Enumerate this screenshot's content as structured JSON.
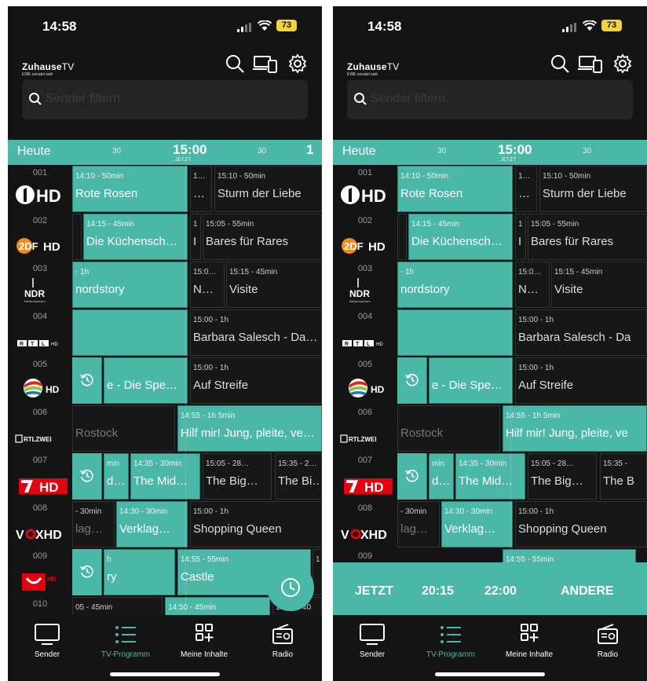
{
  "status": {
    "time": "14:58",
    "battery": "73"
  },
  "app": {
    "brand": "Zuhause",
    "brand_suffix": "TV",
    "tagline": "EWE osnatel swb"
  },
  "search": {
    "placeholder": "Sender filtern"
  },
  "timeline": {
    "day": "Heute",
    "half_left": "30",
    "current": "15:00",
    "now_label": "JETZT",
    "half_right": "30",
    "next_partial": "1"
  },
  "channels": [
    {
      "num": "001",
      "logo": "ARD HD",
      "logo_icon": "das-erste-hd-logo"
    },
    {
      "num": "002",
      "logo": "ZDF HD",
      "logo_icon": "zdf-hd-logo"
    },
    {
      "num": "003",
      "logo": "NDR",
      "logo_icon": "ndr-logo"
    },
    {
      "num": "004",
      "logo": "RTL HD",
      "logo_icon": "rtl-hd-logo"
    },
    {
      "num": "005",
      "logo": "SAT.1 HD",
      "logo_icon": "sat1-hd-logo"
    },
    {
      "num": "006",
      "logo": "RTLZWEI",
      "logo_icon": "rtlzwei-logo"
    },
    {
      "num": "007",
      "logo": "7 HD",
      "logo_icon": "pro7-hd-logo"
    },
    {
      "num": "008",
      "logo": "VOX HD",
      "logo_icon": "vox-hd-logo"
    },
    {
      "num": "009",
      "logo": "kabel eins HD",
      "logo_icon": "kabel-eins-hd-logo"
    },
    {
      "num": "010",
      "logo": "",
      "logo_icon": ""
    }
  ],
  "left": {
    "programs": [
      [
        {
          "t": "14:10 - 50min",
          "n": "Rote Rosen"
        },
        {
          "t": "1…",
          "n": "…"
        },
        {
          "t": "15:10 - 50min",
          "n": "Sturm der Liebe"
        }
      ],
      [
        {
          "t": "14:15 - 45min",
          "n": "Die Küchensch…"
        },
        {
          "t": "1",
          "n": "I"
        },
        {
          "t": "15:05 - 55min",
          "n": "Bares für Rares"
        }
      ],
      [
        {
          "t": "- 1h",
          "n": "nordstory"
        },
        {
          "t": "15:0…",
          "n": "N…"
        },
        {
          "t": "15:15 - 45min",
          "n": "Visite"
        }
      ],
      [
        {
          "t": "",
          "n": ""
        },
        {
          "t": "15:00 - 1h",
          "n": "Barbara Salesch - Da…"
        }
      ],
      [
        {
          "t": "",
          "n": "e - Die Spe…"
        },
        {
          "t": "15:00 - 1h",
          "n": "Auf Streife"
        }
      ],
      [
        {
          "t": "",
          "n": "Rostock"
        },
        {
          "t": "14:55 - 1h 5min",
          "n": "Hilf mir! Jung, pleite, ve…"
        }
      ],
      [
        {
          "t": "min",
          "n": "d…"
        },
        {
          "t": "14:35 - 30min",
          "n": "The Mid…"
        },
        {
          "t": "15:05 - 28…",
          "n": "The Big…"
        },
        {
          "t": "15:35 - 2…",
          "n": "The Bi…"
        }
      ],
      [
        {
          "t": "- 30min",
          "n": "lag…"
        },
        {
          "t": "14:30 - 30min",
          "n": "Verklag…"
        },
        {
          "t": "15:00 - 1h",
          "n": "Shopping Queen"
        }
      ],
      [
        {
          "t": "h",
          "n": "ry"
        },
        {
          "t": "14:55 - 55min",
          "n": "Castle"
        },
        {
          "t": "1",
          "n": ""
        }
      ],
      [
        {
          "t": "05 - 45min",
          "n": ""
        },
        {
          "t": "14:50 - 45min",
          "n": ""
        },
        {
          "t": "15:35 - 40",
          "n": ""
        }
      ]
    ]
  },
  "right": {
    "programs": [
      [
        {
          "t": "14:10 - 50min",
          "n": "Rote Rosen"
        },
        {
          "t": "1…",
          "n": "…"
        },
        {
          "t": "15:10 - 50min",
          "n": "Sturm der Liebe"
        }
      ],
      [
        {
          "t": "14:15 - 45min",
          "n": "Die Küchensch…"
        },
        {
          "t": "1",
          "n": "I"
        },
        {
          "t": "15:05 - 55min",
          "n": "Bares für Rares"
        }
      ],
      [
        {
          "t": "- 1h",
          "n": "nordstory"
        },
        {
          "t": "15:0…",
          "n": "N…"
        },
        {
          "t": "15:15 - 45min",
          "n": "Visite"
        }
      ],
      [
        {
          "t": "",
          "n": ""
        },
        {
          "t": "15:00 - 1h",
          "n": "Barbara Salesch - Da"
        }
      ],
      [
        {
          "t": "",
          "n": "e - Die Spe…"
        },
        {
          "t": "15:00 - 1h",
          "n": "Auf Streife"
        }
      ],
      [
        {
          "t": "",
          "n": "Rostock"
        },
        {
          "t": "14:55 - 1h 5min",
          "n": "Hilf mir! Jung, pleite, ve"
        }
      ],
      [
        {
          "t": "min",
          "n": "d…"
        },
        {
          "t": "14:35 - 30min",
          "n": "The Mid…"
        },
        {
          "t": "15:05 - 28…",
          "n": "The Big…"
        },
        {
          "t": "15:35 -",
          "n": "The B"
        }
      ],
      [
        {
          "t": "- 30min",
          "n": "lag…"
        },
        {
          "t": "14:30 - 30min",
          "n": "Verklag…"
        },
        {
          "t": "15:00 - 1h",
          "n": "Shopping Queen"
        }
      ],
      [
        {
          "t": "",
          "n": ""
        },
        {
          "t": "14:55 - 55min",
          "n": ""
        }
      ]
    ]
  },
  "quickbar": {
    "now": "JETZT",
    "t1": "20:15",
    "t2": "22:00",
    "other": "ANDERE"
  },
  "nav": [
    {
      "label": "Sender",
      "icon": "tv-icon"
    },
    {
      "label": "TV-Programm",
      "icon": "list-icon"
    },
    {
      "label": "Meine Inhalte",
      "icon": "grid-plus-icon"
    },
    {
      "label": "Radio",
      "icon": "radio-icon"
    }
  ],
  "colors": {
    "accent": "#4bb7a7",
    "background": "#141414",
    "tile_dark": "#171717",
    "battery": "#f3d33c"
  }
}
